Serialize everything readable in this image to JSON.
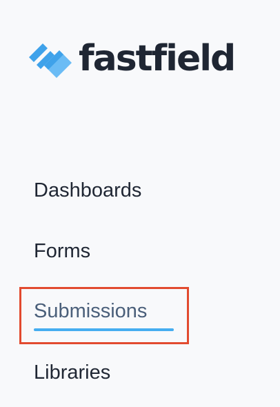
{
  "brand": {
    "name": "fastfield",
    "logo_icon": "fastfield-logo-icon",
    "text_color": "#1f2633",
    "icon_colors": [
      "#3fa2ea",
      "#6bbcf5"
    ]
  },
  "nav": {
    "items": [
      {
        "label": "Dashboards",
        "active": false
      },
      {
        "label": "Forms",
        "active": false
      },
      {
        "label": "Submissions",
        "active": true
      },
      {
        "label": "Libraries",
        "active": false
      }
    ],
    "active_underline_color": "#45adf0",
    "highlight_color": "#e24a2f"
  }
}
